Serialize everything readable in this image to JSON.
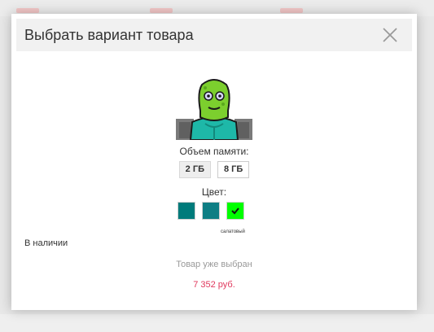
{
  "modal": {
    "title": "Выбрать вариант товара",
    "close_icon": "close-icon"
  },
  "product": {
    "image_icon": "product-avatar"
  },
  "memory": {
    "label": "Объем памяти:",
    "options": [
      {
        "label": "2 ГБ",
        "selected": true
      },
      {
        "label": "8 ГБ",
        "selected": false
      }
    ]
  },
  "color": {
    "label": "Цвет:",
    "swatches": [
      {
        "color": "#007b7b",
        "selected": false
      },
      {
        "color": "#0e7e84",
        "selected": false
      },
      {
        "color": "#00ff00",
        "selected": true
      }
    ],
    "selected_caption": "салатовый"
  },
  "stock": "В наличии",
  "selected_text": "Товар уже выбран",
  "price": "7 352 руб.",
  "colors": {
    "price": "#e0375c",
    "header_bg": "#f1f1f1"
  }
}
